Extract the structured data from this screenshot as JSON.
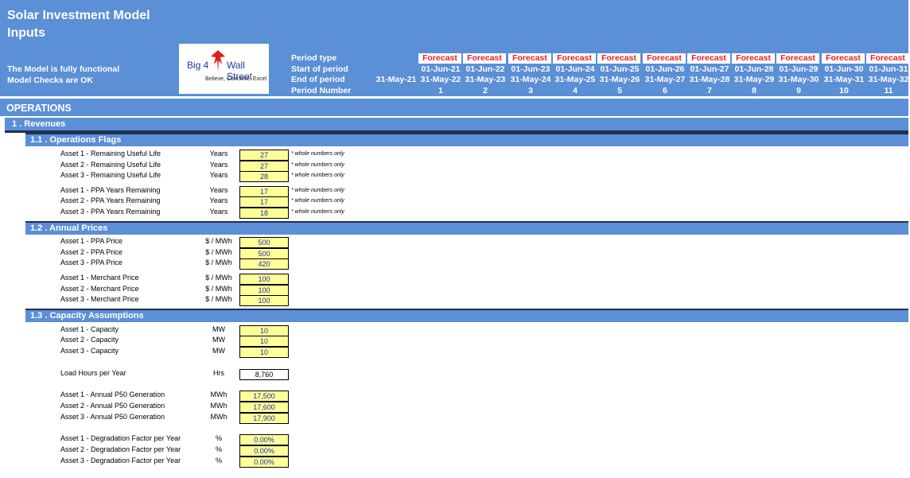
{
  "header": {
    "title_line1": "Solar Investment Model",
    "title_line2": "Inputs",
    "status_line1": "The Model is fully functional",
    "status_line2": "Model Checks are OK",
    "logo": {
      "big4": "Big 4",
      "wallstreet": "Wall Street",
      "tagline": "Believe, Conceive, Excel",
      "icon": "eagle-icon"
    },
    "row_labels": [
      "Period type",
      "Start of period",
      "End of period",
      "Period Number"
    ],
    "initial_end": "31-May-21",
    "periods": [
      {
        "type": "Forecast",
        "start": "01-Jun-21",
        "end": "31-May-22",
        "num": "1"
      },
      {
        "type": "Forecast",
        "start": "01-Jun-22",
        "end": "31-May-23",
        "num": "2"
      },
      {
        "type": "Forecast",
        "start": "01-Jun-23",
        "end": "31-May-24",
        "num": "3"
      },
      {
        "type": "Forecast",
        "start": "01-Jun-24",
        "end": "31-May-25",
        "num": "4"
      },
      {
        "type": "Forecast",
        "start": "01-Jun-25",
        "end": "31-May-26",
        "num": "5"
      },
      {
        "type": "Forecast",
        "start": "01-Jun-26",
        "end": "31-May-27",
        "num": "6"
      },
      {
        "type": "Forecast",
        "start": "01-Jun-27",
        "end": "31-May-28",
        "num": "7"
      },
      {
        "type": "Forecast",
        "start": "01-Jun-28",
        "end": "31-May-29",
        "num": "8"
      },
      {
        "type": "Forecast",
        "start": "01-Jun-29",
        "end": "31-May-30",
        "num": "9"
      },
      {
        "type": "Forecast",
        "start": "01-Jun-30",
        "end": "31-May-31",
        "num": "10"
      },
      {
        "type": "Forecast",
        "start": "01-Jun-31",
        "end": "31-May-32",
        "num": "11"
      }
    ]
  },
  "operations": {
    "title": "OPERATIONS"
  },
  "revenues": {
    "title": "1 . Revenues"
  },
  "sections": [
    {
      "title": "1.1 . Operations Flags",
      "rows": [
        {
          "label": "Asset 1 - Remaining Useful Life",
          "unit": "Years",
          "value": "27",
          "note": "* whole numbers only"
        },
        {
          "label": "Asset 2 - Remaining Useful Life",
          "unit": "Years",
          "value": "27",
          "note": "* whole numbers only"
        },
        {
          "label": "Asset 3 - Remaining Useful Life",
          "unit": "Years",
          "value": "28",
          "note": "* whole numbers only"
        },
        {
          "label": "Asset 1 - PPA Years Remaining",
          "unit": "Years",
          "value": "17",
          "note": "* whole numbers only"
        },
        {
          "label": "Asset 2 - PPA Years Remaining",
          "unit": "Years",
          "value": "17",
          "note": "* whole numbers only"
        },
        {
          "label": "Asset 3 - PPA Years Remaining",
          "unit": "Years",
          "value": "18",
          "note": "* whole numbers only"
        }
      ]
    },
    {
      "title": "1.2 . Annual Prices",
      "rows": [
        {
          "label": "Asset 1 - PPA Price",
          "unit": "$ / MWh",
          "value": "500"
        },
        {
          "label": "Asset 2 - PPA Price",
          "unit": "$ / MWh",
          "value": "500"
        },
        {
          "label": "Asset 3 - PPA Price",
          "unit": "$ / MWh",
          "value": "420"
        },
        {
          "label": "Asset 1 - Merchant Price",
          "unit": "$ / MWh",
          "value": "100"
        },
        {
          "label": "Asset 2 - Merchant Price",
          "unit": "$ / MWh",
          "value": "100"
        },
        {
          "label": "Asset 3 - Merchant Price",
          "unit": "$ / MWh",
          "value": "100"
        }
      ]
    },
    {
      "title": "1.3 . Capacity Assumptions",
      "rows": [
        {
          "label": "Asset 1 - Capacity",
          "unit": "MW",
          "value": "10"
        },
        {
          "label": "Asset 2 - Capacity",
          "unit": "MW",
          "value": "10"
        },
        {
          "label": "Asset 3 - Capacity",
          "unit": "MW",
          "value": "10"
        },
        {
          "label": "Load Hours per Year",
          "unit": "Hrs",
          "value": "8,760"
        },
        {
          "label": "Asset 1 - Annual P50 Generation",
          "unit": "MWh",
          "value": "17,500"
        },
        {
          "label": "Asset 2 - Annual P50 Generation",
          "unit": "MWh",
          "value": "17,600"
        },
        {
          "label": "Asset 3 - Annual P50 Generation",
          "unit": "MWh",
          "value": "17,900"
        },
        {
          "label": "Asset 1 - Degradation Factor per Year",
          "unit": "%",
          "value": "0.00%"
        },
        {
          "label": "Asset 2 - Degradation Factor per Year",
          "unit": "%",
          "value": "0.00%"
        },
        {
          "label": "Asset 3 - Degradation Factor per Year",
          "unit": "%",
          "value": "0.00%"
        }
      ]
    }
  ],
  "colors": {
    "header_blue": "#5b8fd6",
    "input_yellow": "#ffff99",
    "input_text": "#1f2ea8",
    "forecast_red": "#e8202a"
  }
}
